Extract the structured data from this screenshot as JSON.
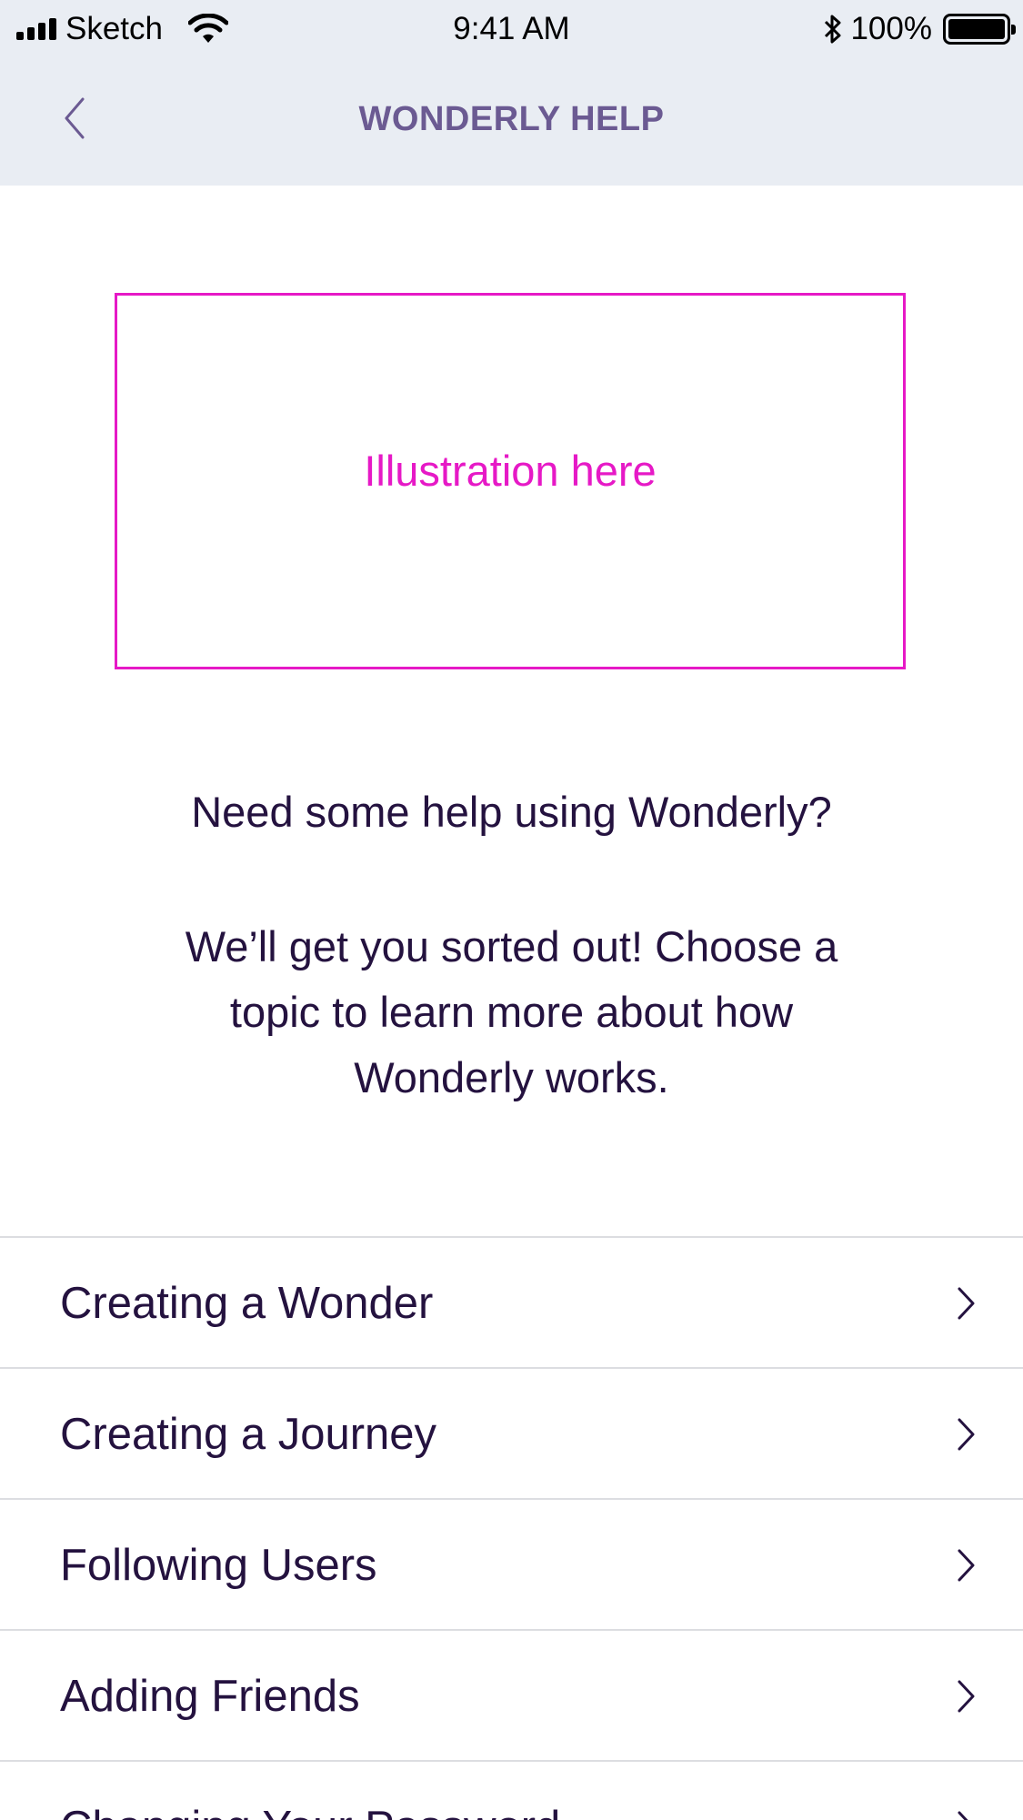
{
  "status_bar": {
    "carrier": "Sketch",
    "time": "9:41 AM",
    "battery_percent": "100%",
    "icons": [
      "signal-bars-icon",
      "wifi-icon",
      "bluetooth-icon",
      "battery-icon"
    ]
  },
  "nav": {
    "back_icon": "chevron-left-icon",
    "title": "WONDERLY HELP"
  },
  "illustration": {
    "placeholder": "Illustration here"
  },
  "intro": {
    "heading": "Need some help using Wonderly?",
    "body": "We’ll get you sorted out! Choose a topic to learn more about how Wonderly works."
  },
  "topics": [
    {
      "label": "Creating a Wonder",
      "icon": "chevron-right-icon"
    },
    {
      "label": "Creating a Journey",
      "icon": "chevron-right-icon"
    },
    {
      "label": "Following Users",
      "icon": "chevron-right-icon"
    },
    {
      "label": "Adding Friends",
      "icon": "chevron-right-icon"
    },
    {
      "label": "Changing Your Password",
      "icon": "chevron-right-icon"
    }
  ],
  "colors": {
    "header_background": "#e9edf3",
    "title_purple": "#6b5a92",
    "text_dark": "#24123f",
    "placeholder_magenta": "#e619c6",
    "divider": "#dcdde1"
  }
}
